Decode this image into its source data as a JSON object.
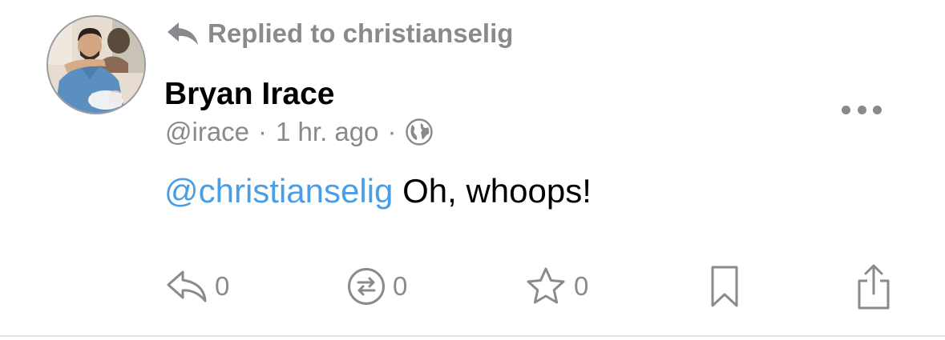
{
  "post": {
    "reply_to": "Replied to christianselig",
    "author": {
      "display_name": "Bryan Irace",
      "handle": "@irace"
    },
    "separator": "·",
    "time_ago": "1 hr. ago",
    "visibility_icon": "globe-icon",
    "content": {
      "mention": "@christianselig",
      "text": " Oh, whoops!"
    },
    "actions": {
      "reply_count": "0",
      "boost_count": "0",
      "favorite_count": "0"
    }
  },
  "colors": {
    "secondary_text": "#8a8a8e",
    "mention": "#4a9ee6",
    "primary_text": "#000000",
    "divider": "#e4e4e7"
  }
}
